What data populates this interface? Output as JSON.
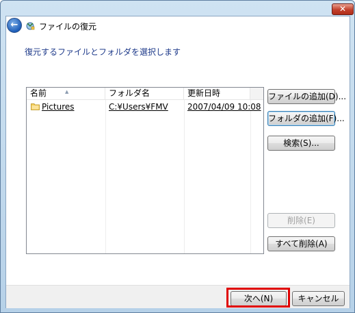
{
  "window": {
    "title": "ファイルの復元",
    "close_glyph": "✕"
  },
  "instruction": "復元するファイルとフォルダを選択します",
  "file_list": {
    "columns": [
      "名前",
      "フォルダ名",
      "更新日時"
    ],
    "rows": [
      {
        "name": "Pictures",
        "folder": "C:¥Users¥FMV",
        "modified": "2007/04/09 10:08"
      }
    ]
  },
  "side_buttons": {
    "add_files": "ファイルの追加(D)...",
    "add_folders": "フォルダの追加(F)...",
    "search": "検索(S)...",
    "remove": "削除(E)",
    "remove_all": "すべて削除(A)"
  },
  "footer": {
    "next": "次へ(N)",
    "cancel": "キャンセル"
  },
  "colors": {
    "highlight": "#e00000",
    "instruction_text": "#1e3a8a",
    "close_button": "#c3412c"
  },
  "icons": [
    "back-arrow-icon",
    "backup-restore-icon",
    "folder-icon",
    "sort-indicator-icon",
    "close-icon"
  ]
}
